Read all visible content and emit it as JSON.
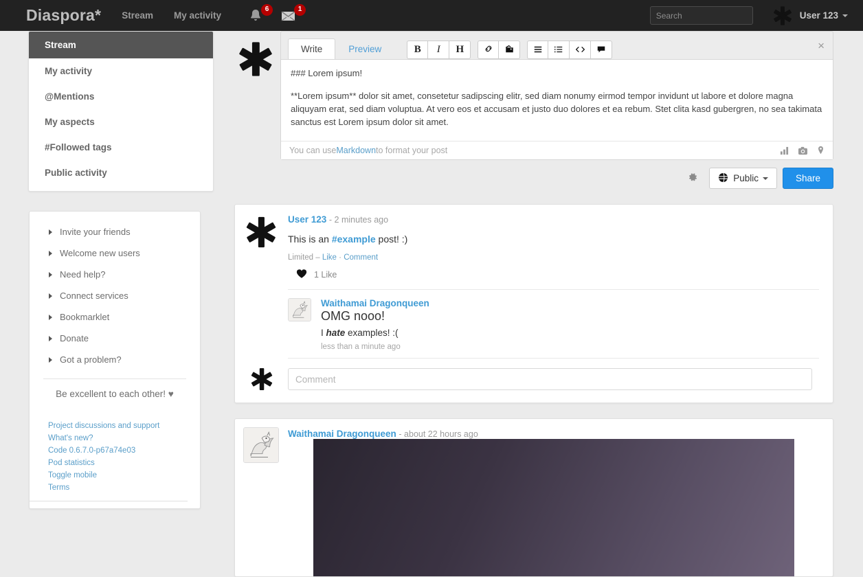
{
  "header": {
    "brand": "Diaspora*",
    "nav": [
      {
        "label": "Stream",
        "name": "nav-stream"
      },
      {
        "label": "My activity",
        "name": "nav-my-activity"
      }
    ],
    "notifications": {
      "icon": "bell-icon",
      "count": "6"
    },
    "messages": {
      "icon": "envelope-icon",
      "count": "1"
    },
    "search": {
      "placeholder": "Search",
      "value": ""
    },
    "user": {
      "name": "User 123",
      "avatar_icon": "asterisk-avatar"
    }
  },
  "sidebar": {
    "nav_items": [
      {
        "label": "Stream",
        "active": true
      },
      {
        "label": "My activity",
        "active": false
      },
      {
        "label": "@Mentions",
        "active": false
      },
      {
        "label": "My aspects",
        "active": false
      },
      {
        "label": "#Followed tags",
        "active": false
      },
      {
        "label": "Public activity",
        "active": false
      }
    ],
    "help_items": [
      "Invite your friends",
      "Welcome new users",
      "Need help?",
      "Connect services",
      "Bookmarklet",
      "Donate",
      "Got a problem?"
    ],
    "be_excellent": "Be excellent to each other!",
    "heart": "♥",
    "footer_links": [
      "Project discussions and support",
      "What's new?",
      "Code 0.6.7.0-p67a74e03",
      "Pod statistics",
      "Toggle mobile",
      "Terms"
    ]
  },
  "publisher": {
    "tabs": [
      {
        "label": "Write",
        "active": true
      },
      {
        "label": "Preview",
        "active": false
      }
    ],
    "format_buttons": [
      {
        "label": "B",
        "name": "bold-button"
      },
      {
        "label": "I",
        "name": "italic-button"
      },
      {
        "label": "H",
        "name": "heading-button"
      }
    ],
    "insert_buttons": [
      {
        "label": "link-icon",
        "name": "link-button"
      },
      {
        "label": "image-icon",
        "name": "image-button"
      }
    ],
    "block_buttons": [
      {
        "label": "align-icon",
        "name": "unordered-block-button"
      },
      {
        "label": "list-icon",
        "name": "list-button"
      },
      {
        "label": "code-icon",
        "name": "code-button"
      },
      {
        "label": "quote-icon",
        "name": "quote-button"
      }
    ],
    "close_label": "×",
    "text_line1": "### Lorem ipsum!",
    "text_line2": "**Lorem ipsum** dolor sit amet, consetetur sadipscing elitr, sed diam nonumy eirmod tempor invidunt ut labore et dolore magna aliquyam erat, sed diam voluptua. At vero eos et accusam et justo duo dolores et ea rebum. Stet clita kasd gubergren, no sea takimata sanctus est Lorem ipsum dolor sit amet.",
    "hint_prefix": "You can use ",
    "hint_link": "Markdown",
    "hint_suffix": " to format your post",
    "hint_icons": [
      "poll-icon",
      "camera-icon",
      "location-icon"
    ],
    "settings_icon": "gear-icon",
    "aspect_label": "Public",
    "aspect_icon": "globe-icon",
    "share_label": "Share"
  },
  "posts": [
    {
      "author": "User 123",
      "time": "- 2 minutes ago",
      "avatar_icon": "asterisk-avatar",
      "text_before": "This is an ",
      "hashtag": "#example",
      "text_after": " post! :)",
      "visibility": "Limited – ",
      "like_label": "Like",
      "meta_sep": " · ",
      "comment_label": "Comment",
      "heart_icon": "heart-icon",
      "likes_count": "1 Like",
      "comments": [
        {
          "author": "Waithamai Dragonqueen",
          "avatar_icon": "dragon-avatar",
          "headline": "OMG nooo!",
          "body_before": "I ",
          "body_emph": "hate",
          "body_after": " examples! :(",
          "time": "less than a minute ago"
        }
      ],
      "comment_placeholder": "Comment",
      "comment_avatar_icon": "asterisk-avatar"
    },
    {
      "author": "Waithamai Dragonqueen",
      "time": "- about 22 hours ago",
      "avatar_icon": "dragon-avatar",
      "image_alt": "dark-purple-photo"
    }
  ],
  "colors": {
    "header_bg": "#222222",
    "accent_blue": "#3f9bd4",
    "share_blue": "#2090ea",
    "badge_red": "#b40000",
    "page_bg": "#ebebeb",
    "active_nav": "#555555"
  }
}
